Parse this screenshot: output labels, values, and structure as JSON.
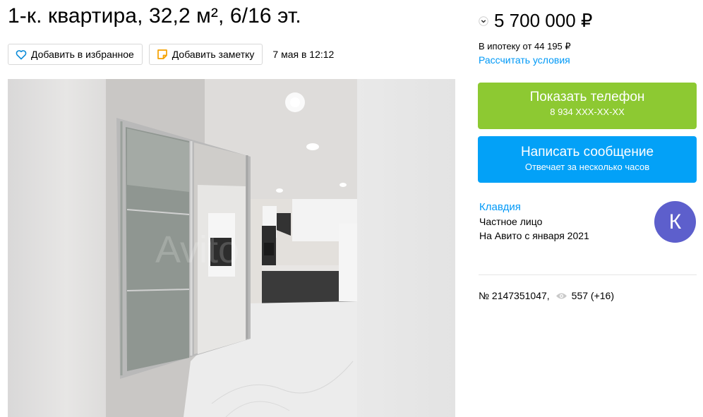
{
  "listing": {
    "title": "1-к. квартира, 32,2 м², 6/16 эт.",
    "favorite_label": "Добавить в избранное",
    "note_label": "Добавить заметку",
    "date": "7 мая в 12:12",
    "watermark": "Avito"
  },
  "price": {
    "value": "5 700 000 ₽",
    "mortgage": "В ипотеку от 44 195 ₽",
    "calc_link": "Рассчитать условия"
  },
  "contact": {
    "phone_label": "Показать телефон",
    "phone_masked": "8 934 XXX-XX-XX",
    "message_label": "Написать сообщение",
    "response_time": "Отвечает за несколько часов",
    "colors": {
      "phone_button": "#8dc932",
      "message_button": "#03a1f7",
      "link": "#0099f7"
    }
  },
  "seller": {
    "name": "Клавдия",
    "type": "Частное лицо",
    "since": "На Авито с января 2021",
    "avatar_letter": "К",
    "avatar_color": "#5d5fcc"
  },
  "stats": {
    "item_number": "№ 2147351047,",
    "views": "557 (+16)"
  },
  "icons": [
    "heart-icon",
    "note-icon",
    "chevron-down-icon",
    "eye-icon"
  ]
}
